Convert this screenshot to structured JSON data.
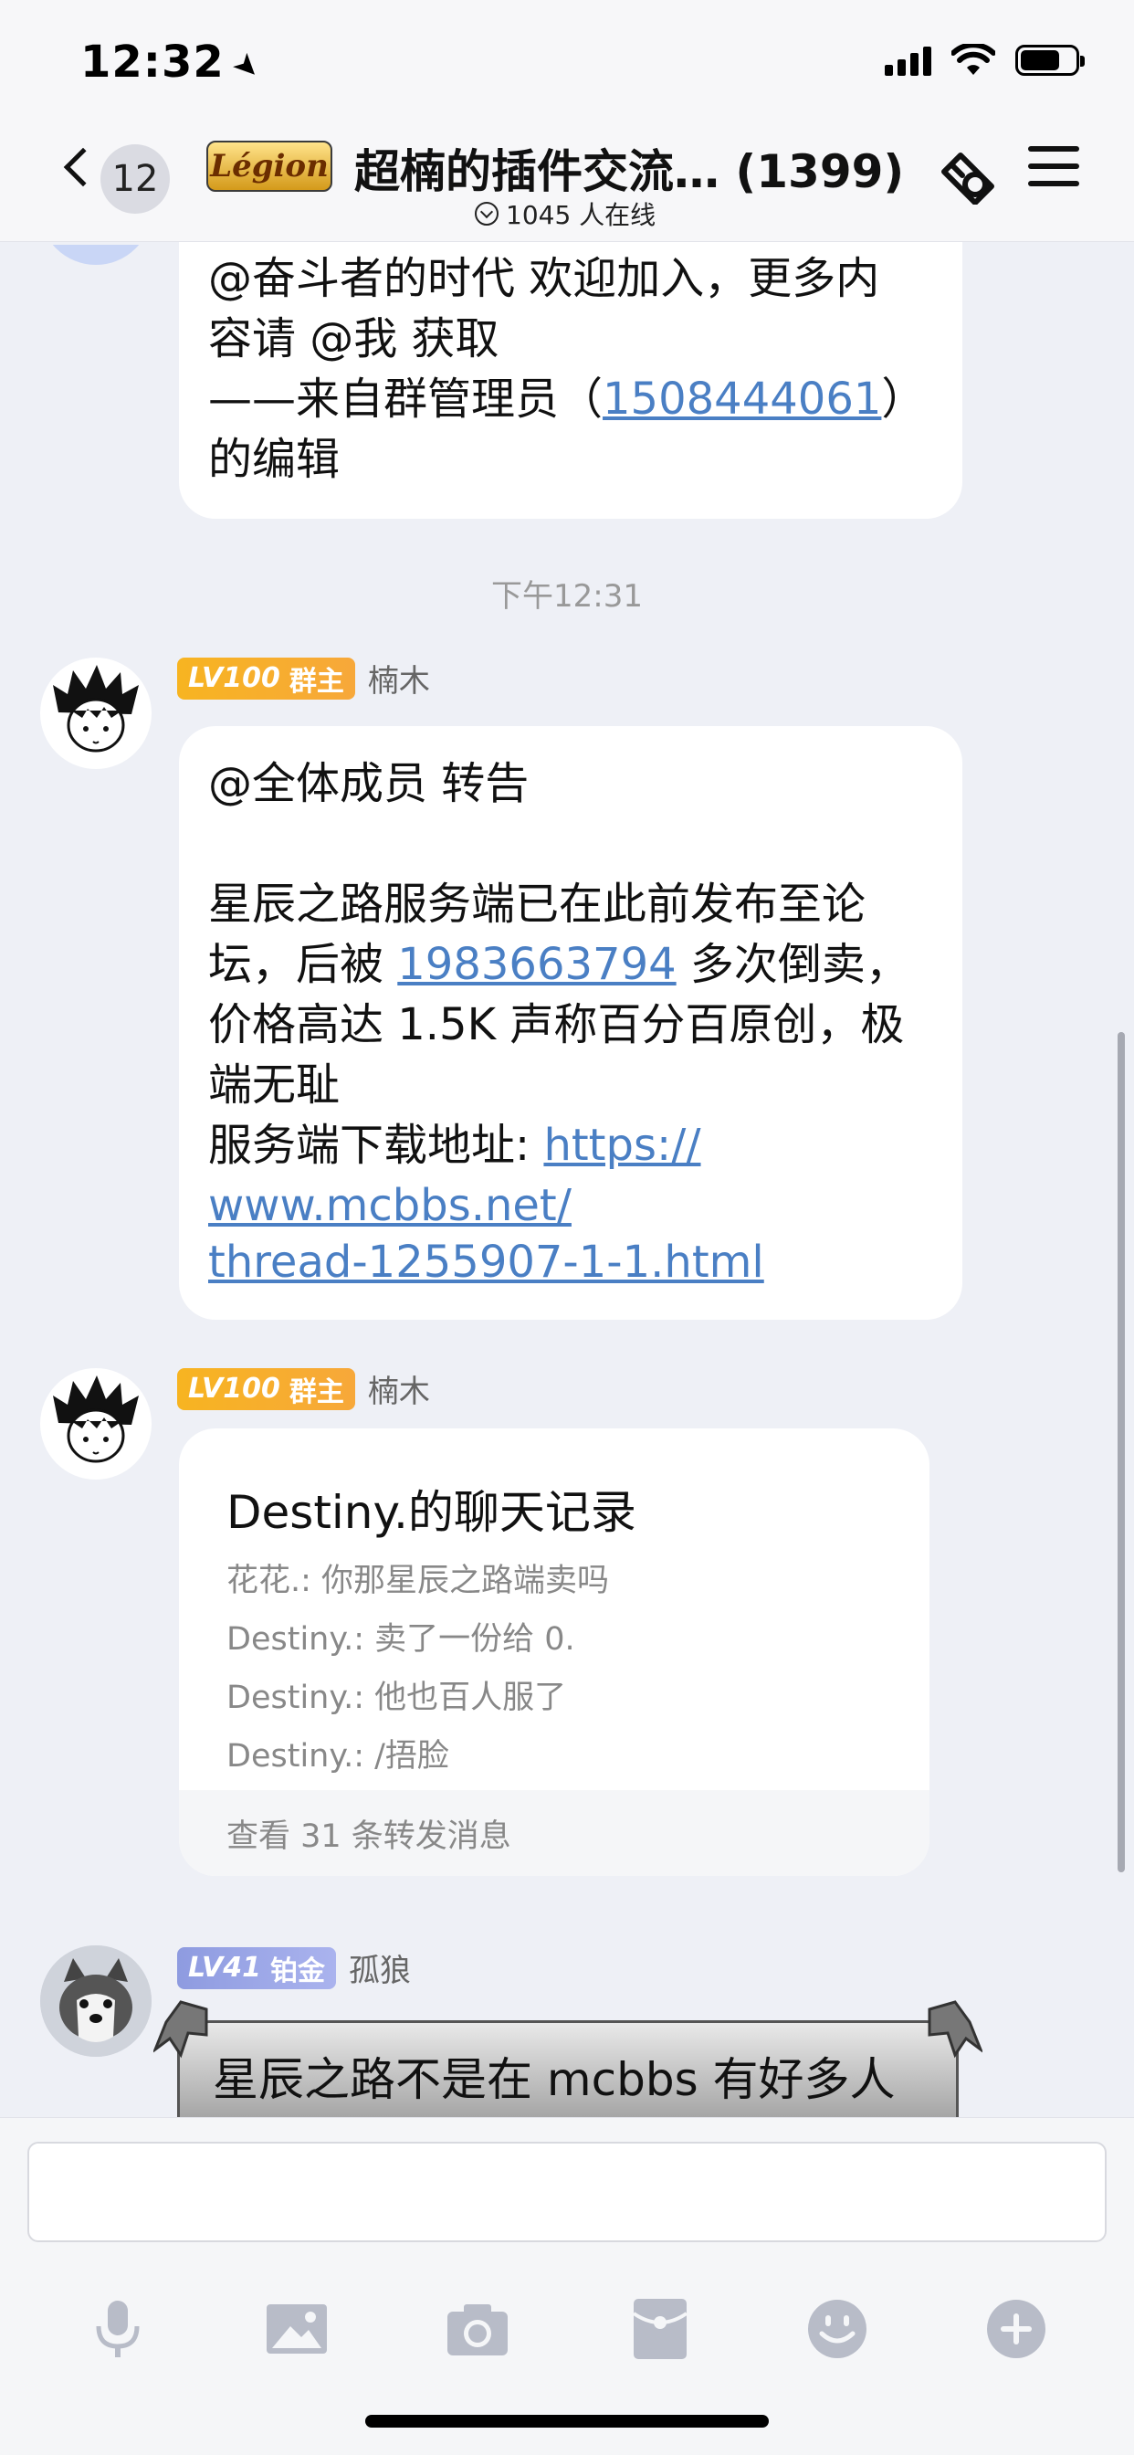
{
  "status_bar": {
    "time": "12:32"
  },
  "header": {
    "unread_count": "12",
    "group_logo_text": "Légion",
    "group_title": "超楠的插件交流… (1399)",
    "online_text": "1045 人在线"
  },
  "messages": {
    "prev_bubble": {
      "line1": "@奋斗者的时代 欢迎加入，更多内",
      "line2": "容请 @我 获取",
      "line3_prefix": "——来自群管理员（",
      "line3_link": "1508444061",
      "line3_suffix": "）",
      "line4": "的编辑"
    },
    "timestamp": "下午12:31",
    "msg1": {
      "level": "LV100",
      "role": "群主",
      "sender": "楠木",
      "line1": "@全体成员 转告",
      "line2": "星辰之路服务端已在此前发布至论",
      "line3_prefix": "坛，后被 ",
      "line3_link": "1983663794",
      "line3_suffix": " 多次倒卖，",
      "line4": "价格高达 1.5K 声称百分百原创，极",
      "line5": "端无耻",
      "line6_prefix": "服务端下载地址: ",
      "url_line1": "https://",
      "url_line2": "www.mcbbs.net/",
      "url_line3": "thread-1255907-1-1.html"
    },
    "msg2": {
      "level": "LV100",
      "role": "群主",
      "sender": "楠木",
      "forward_title": "Destiny.的聊天记录",
      "lines": [
        "花花.: 你那星辰之路端卖吗",
        "Destiny.: 卖了一份给 0.",
        "Destiny.: 他也百人服了",
        "Destiny.: /捂脸"
      ],
      "footer": "查看 31 条转发消息"
    },
    "msg3": {
      "level": "LV41",
      "role": "铂金",
      "sender": "孤狼",
      "text": "星辰之路不是在 mcbbs 有好多人开"
    }
  },
  "colors": {
    "link": "#4a7fc4",
    "gold_badge": "#f7b421",
    "platinum_badge": "#8e9be0",
    "background": "#eef0f6"
  },
  "toolbar_icons": [
    "microphone-icon",
    "image-icon",
    "camera-icon",
    "red-packet-icon",
    "emoji-icon",
    "plus-icon"
  ]
}
